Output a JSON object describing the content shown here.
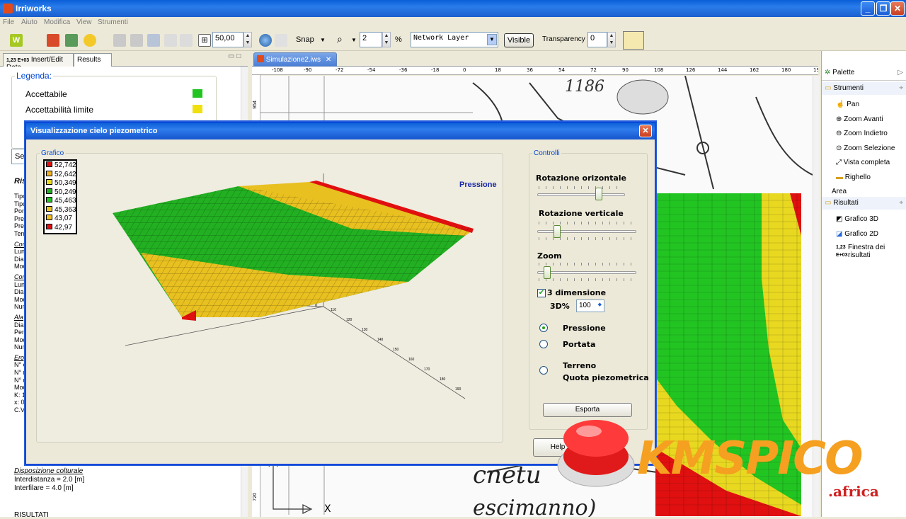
{
  "app": {
    "title": "Irriworks",
    "menus": [
      "File",
      "Aiuto",
      "Modifica",
      "View",
      "Strumenti"
    ]
  },
  "toolbar": {
    "grid_value": "50,00",
    "snap_label": "Snap",
    "zoom_value": "2",
    "percent": "%",
    "layer_select": "Network Layer",
    "visible_btn": "Visible",
    "transparency_label": "Transparency",
    "transparency_value": "0"
  },
  "left_panel": {
    "tab_insert": "Insert/Edit Data",
    "tab_results": "Results",
    "tab_badge": "1,23 E+03",
    "legend_title": "Legenda:",
    "legend": [
      {
        "label": "Accettabile",
        "color": "#22c422"
      },
      {
        "label": "Accettabilità limite",
        "color": "#f0e010"
      }
    ],
    "search_prefix": "Se",
    "section_head": "Ris",
    "side_lines": [
      "Tipo",
      "Tipo",
      "Port",
      "Pres",
      "Pres",
      "Tem",
      "Cond",
      "Lung",
      "Diam",
      "Mod",
      "Cond",
      "Lung",
      "Diam",
      "Mod",
      "Num",
      "Ala",
      "Diam",
      "Pend",
      "Mod",
      "Num",
      "Erog",
      "N° e",
      "N° r",
      "N° r",
      "Mod",
      "K: 1",
      "x: 0",
      "C.V"
    ],
    "dispos_title": "Disposizione colturale",
    "dispos_lines": [
      "Interdistanza = 2.0 [m]",
      "Interfilare = 4.0 [m]"
    ],
    "results_caption": "RISULTATI"
  },
  "editor": {
    "tab_label": "Simulazione2.iws",
    "ruler_ticks": [
      "-108",
      "-90",
      "-72",
      "-54",
      "-36",
      "-18",
      "0",
      "18",
      "36",
      "54",
      "72",
      "90",
      "108",
      "126",
      "144",
      "162",
      "180",
      "198"
    ],
    "ruler_v": [
      "954",
      "720"
    ],
    "map_text1": "1186",
    "map_text2": "cnetu",
    "map_text3": "escimanno)",
    "axis_x": "X"
  },
  "palette": {
    "title": "Palette",
    "group_tools": "Strumenti",
    "tools": [
      "Pan",
      "Zoom Avanti",
      "Zoom Indietro",
      "Zoom Selezione",
      "Vista completa",
      "Righello",
      "Area"
    ],
    "group_results": "Risultati",
    "results": [
      "Grafico 3D",
      "Grafico 2D",
      "Finestra dei risultati"
    ],
    "results_badge": "1,23 E+03"
  },
  "dialog": {
    "title": "Visualizzazione cielo piezometrico",
    "graph_legend": "Grafico",
    "pressure_title": "Pressione",
    "scale": [
      {
        "v": "52,742",
        "c": "#e01010"
      },
      {
        "v": "52,642",
        "c": "#f0b020"
      },
      {
        "v": "50,349",
        "c": "#e8d820"
      },
      {
        "v": "50,249",
        "c": "#22b022"
      },
      {
        "v": "45,463",
        "c": "#22c422"
      },
      {
        "v": "45,363",
        "c": "#e8c020"
      },
      {
        "v": "43,07",
        "c": "#f0c020"
      },
      {
        "v": "42,97",
        "c": "#e01010"
      }
    ],
    "z_ticks": [
      "50",
      "5",
      "0"
    ],
    "axis_ticks": [
      "110",
      "120",
      "130",
      "140",
      "150",
      "160",
      "170",
      "180",
      "190"
    ],
    "controls_legend": "Controlli",
    "rot_h": "Rotazione orizontale",
    "rot_h_value": 0.7,
    "rot_v": "Rotazione verticale",
    "rot_v_value": 0.2,
    "zoom": "Zoom",
    "zoom_value": 0.1,
    "three_d": "3 dimensione",
    "three_d_pct_label": "3D%",
    "three_d_pct": "100",
    "radio_pressione": "Pressione",
    "radio_portata": "Portata",
    "radio_terreno": "Terreno",
    "radio_quota": "Quota piezometrica",
    "export": "Esporta",
    "help": "Help"
  },
  "watermark": {
    "brand": "KMSPICO",
    "domain": ".africa"
  }
}
